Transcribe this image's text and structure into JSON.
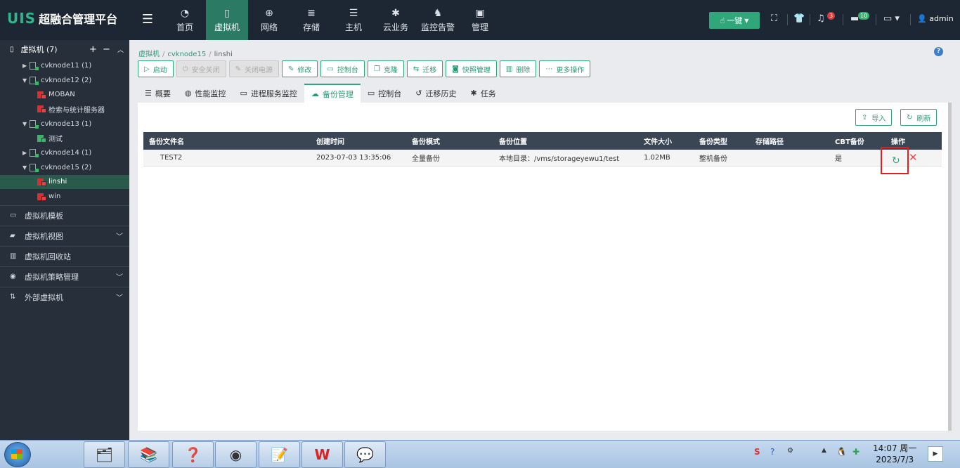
{
  "brand": {
    "mark": "UIS",
    "name": "超融合管理平台"
  },
  "topnav": [
    {
      "label": "首页",
      "icon": "dashboard-icon",
      "glyph": "◔"
    },
    {
      "label": "虚拟机",
      "icon": "vm-icon",
      "glyph": "▯",
      "active": true
    },
    {
      "label": "网络",
      "icon": "globe-icon",
      "glyph": "⊕"
    },
    {
      "label": "存储",
      "icon": "database-icon",
      "glyph": "≣"
    },
    {
      "label": "主机",
      "icon": "server-icon",
      "glyph": "☰"
    },
    {
      "label": "云业务",
      "icon": "gear-icon",
      "glyph": "✱"
    },
    {
      "label": "监控告警",
      "icon": "bell-icon",
      "glyph": "♞"
    },
    {
      "label": "管理",
      "icon": "monitor-icon",
      "glyph": "▣"
    }
  ],
  "header": {
    "onekey_label": "一键",
    "alerts_count": "3",
    "tasks_count": "10",
    "user": "admin"
  },
  "sidebar": {
    "root_label": "虚拟机 (7)",
    "tree": [
      {
        "type": "host",
        "label": "cvknode11 (1)",
        "expanded": false
      },
      {
        "type": "host",
        "label": "cvknode12 (2)",
        "expanded": true
      },
      {
        "type": "vm",
        "label": "MOBAN",
        "state": "stopped"
      },
      {
        "type": "vm",
        "label": "检索与统计服务器",
        "state": "stopped"
      },
      {
        "type": "host",
        "label": "cvknode13 (1)",
        "expanded": true
      },
      {
        "type": "vm",
        "label": "测试",
        "state": "running"
      },
      {
        "type": "host",
        "label": "cvknode14 (1)",
        "expanded": false
      },
      {
        "type": "host",
        "label": "cvknode15 (2)",
        "expanded": true
      },
      {
        "type": "vm",
        "label": "linshi",
        "state": "stopped",
        "active": true
      },
      {
        "type": "vm",
        "label": "win",
        "state": "stopped"
      }
    ],
    "menus": [
      {
        "label": "虚拟机模板",
        "icon": "template-icon",
        "glyph": "▭",
        "chevron": false
      },
      {
        "label": "虚拟机视图",
        "icon": "folder-icon",
        "glyph": "▰",
        "chevron": true
      },
      {
        "label": "虚拟机回收站",
        "icon": "trash-icon",
        "glyph": "▥",
        "chevron": false
      },
      {
        "label": "虚拟机策略管理",
        "icon": "policy-icon",
        "glyph": "◉",
        "chevron": true
      },
      {
        "label": "外部虚拟机",
        "icon": "external-icon",
        "glyph": "⇅",
        "chevron": true
      }
    ]
  },
  "breadcrumb": {
    "root": "虚拟机",
    "host": "cvknode15",
    "current": "linshi"
  },
  "toolbar": [
    {
      "label": "启动",
      "glyph": "▷",
      "disabled": false,
      "name": "start-button"
    },
    {
      "label": "安全关闭",
      "glyph": "⏻",
      "disabled": true,
      "name": "safe-shutdown-button"
    },
    {
      "label": "关闭电源",
      "glyph": "✎",
      "disabled": true,
      "name": "power-off-button"
    },
    {
      "label": "修改",
      "glyph": "✎",
      "disabled": false,
      "name": "edit-button"
    },
    {
      "label": "控制台",
      "glyph": "▭",
      "disabled": false,
      "name": "console-button"
    },
    {
      "label": "克隆",
      "glyph": "❐",
      "disabled": false,
      "name": "clone-button"
    },
    {
      "label": "迁移",
      "glyph": "⇆",
      "disabled": false,
      "name": "migrate-button"
    },
    {
      "label": "快照管理",
      "glyph": "◙",
      "disabled": false,
      "name": "snapshot-button"
    },
    {
      "label": "删除",
      "glyph": "▥",
      "disabled": false,
      "name": "delete-button"
    },
    {
      "label": "更多操作",
      "glyph": "⋯",
      "disabled": false,
      "name": "more-actions-button"
    }
  ],
  "tabs": [
    {
      "label": "概要",
      "glyph": "☰"
    },
    {
      "label": "性能监控",
      "glyph": "◍"
    },
    {
      "label": "进程服务监控",
      "glyph": "▭"
    },
    {
      "label": "备份管理",
      "glyph": "☁",
      "active": true
    },
    {
      "label": "控制台",
      "glyph": "▭"
    },
    {
      "label": "迁移历史",
      "glyph": "↺"
    },
    {
      "label": "任务",
      "glyph": "✱"
    }
  ],
  "panel": {
    "import_label": "导入",
    "refresh_label": "刷新"
  },
  "table": {
    "columns": [
      "备份文件名",
      "创建时间",
      "备份模式",
      "备份位置",
      "文件大小",
      "备份类型",
      "存储路径",
      "CBT备份",
      "操作"
    ],
    "rows": [
      [
        "TEST2",
        "2023-07-03 13:35:06",
        "全量备份",
        "本地目录：/vms/storageyewu1/test",
        "1.02MB",
        "整机备份",
        "",
        "是"
      ]
    ]
  },
  "taskbar": {
    "time": "14:07 周一",
    "date": "2023/7/3"
  }
}
